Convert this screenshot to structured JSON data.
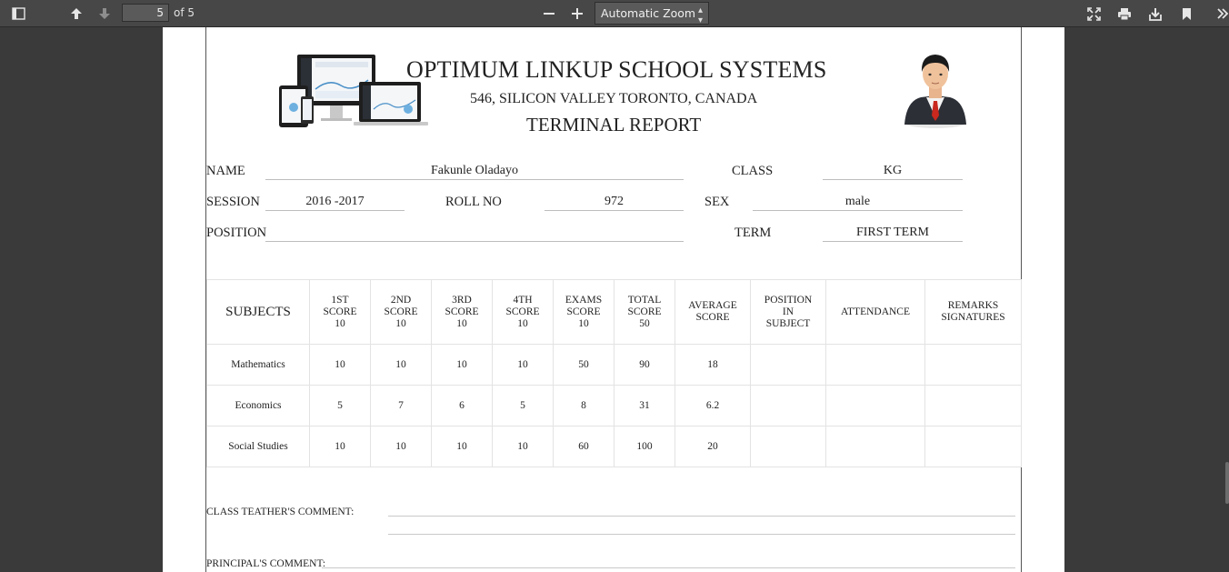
{
  "toolbar": {
    "page_number": "5",
    "page_count_label": "of 5",
    "zoom_label": "Automatic Zoom",
    "icons": [
      "sidebar-toggle-icon",
      "previous-page-icon",
      "next-page-icon",
      "zoom-out-icon",
      "zoom-in-icon",
      "presentation-mode-icon",
      "print-icon",
      "download-icon",
      "bookmark-icon",
      "tools-icon"
    ]
  },
  "document": {
    "school_name": "OPTIMUM LINKUP SCHOOL  SYSTEMS",
    "address": "546,  SILICON  VALLEY TORONTO,  CANADA",
    "report_title": "TERMINAL REPORT",
    "fields": {
      "name_label": "NAME",
      "name_value": "Fakunle  Oladayo",
      "class_label": "CLASS",
      "class_value": "KG",
      "session_label": "SESSION",
      "session_value": "2016 -2017",
      "roll_label": "ROLL NO",
      "roll_value": "972",
      "sex_label": "SEX",
      "sex_value": "male",
      "position_label": "POSITION",
      "position_value": "",
      "term_label": "TERM",
      "term_value": "FIRST  TERM"
    },
    "table": {
      "headers": [
        [
          "SUBJECTS"
        ],
        [
          "1ST",
          "SCORE",
          "10"
        ],
        [
          "2ND",
          "SCORE",
          "10"
        ],
        [
          "3RD",
          "SCORE",
          "10"
        ],
        [
          "4TH",
          "SCORE",
          "10"
        ],
        [
          "EXAMS",
          "SCORE",
          "10"
        ],
        [
          "TOTAL",
          "SCORE",
          "50"
        ],
        [
          "AVERAGE",
          "SCORE"
        ],
        [
          "POSITION",
          "IN",
          "SUBJECT"
        ],
        [
          "ATTENDANCE"
        ],
        [
          "REMARKS",
          "SIGNATURES"
        ]
      ],
      "rows": [
        [
          "Mathematics",
          "10",
          "10",
          "10",
          "10",
          "50",
          "90",
          "18",
          "",
          "",
          ""
        ],
        [
          "Economics",
          "5",
          "7",
          "6",
          "5",
          "8",
          "31",
          "6.2",
          "",
          "",
          ""
        ],
        [
          "Social  Studies",
          "10",
          "10",
          "10",
          "10",
          "60",
          "100",
          "20",
          "",
          "",
          ""
        ]
      ]
    },
    "comments": {
      "class_teacher_label": "CLASS  TEATHER'S  COMMENT:",
      "principal_label": "PRINCIPAL'S  COMMENT:"
    }
  },
  "colors": {
    "toolbar_bg": "#474747",
    "viewer_bg": "#3a3a3a",
    "page_bg": "#ffffff",
    "tie_red": "#c8281e"
  }
}
